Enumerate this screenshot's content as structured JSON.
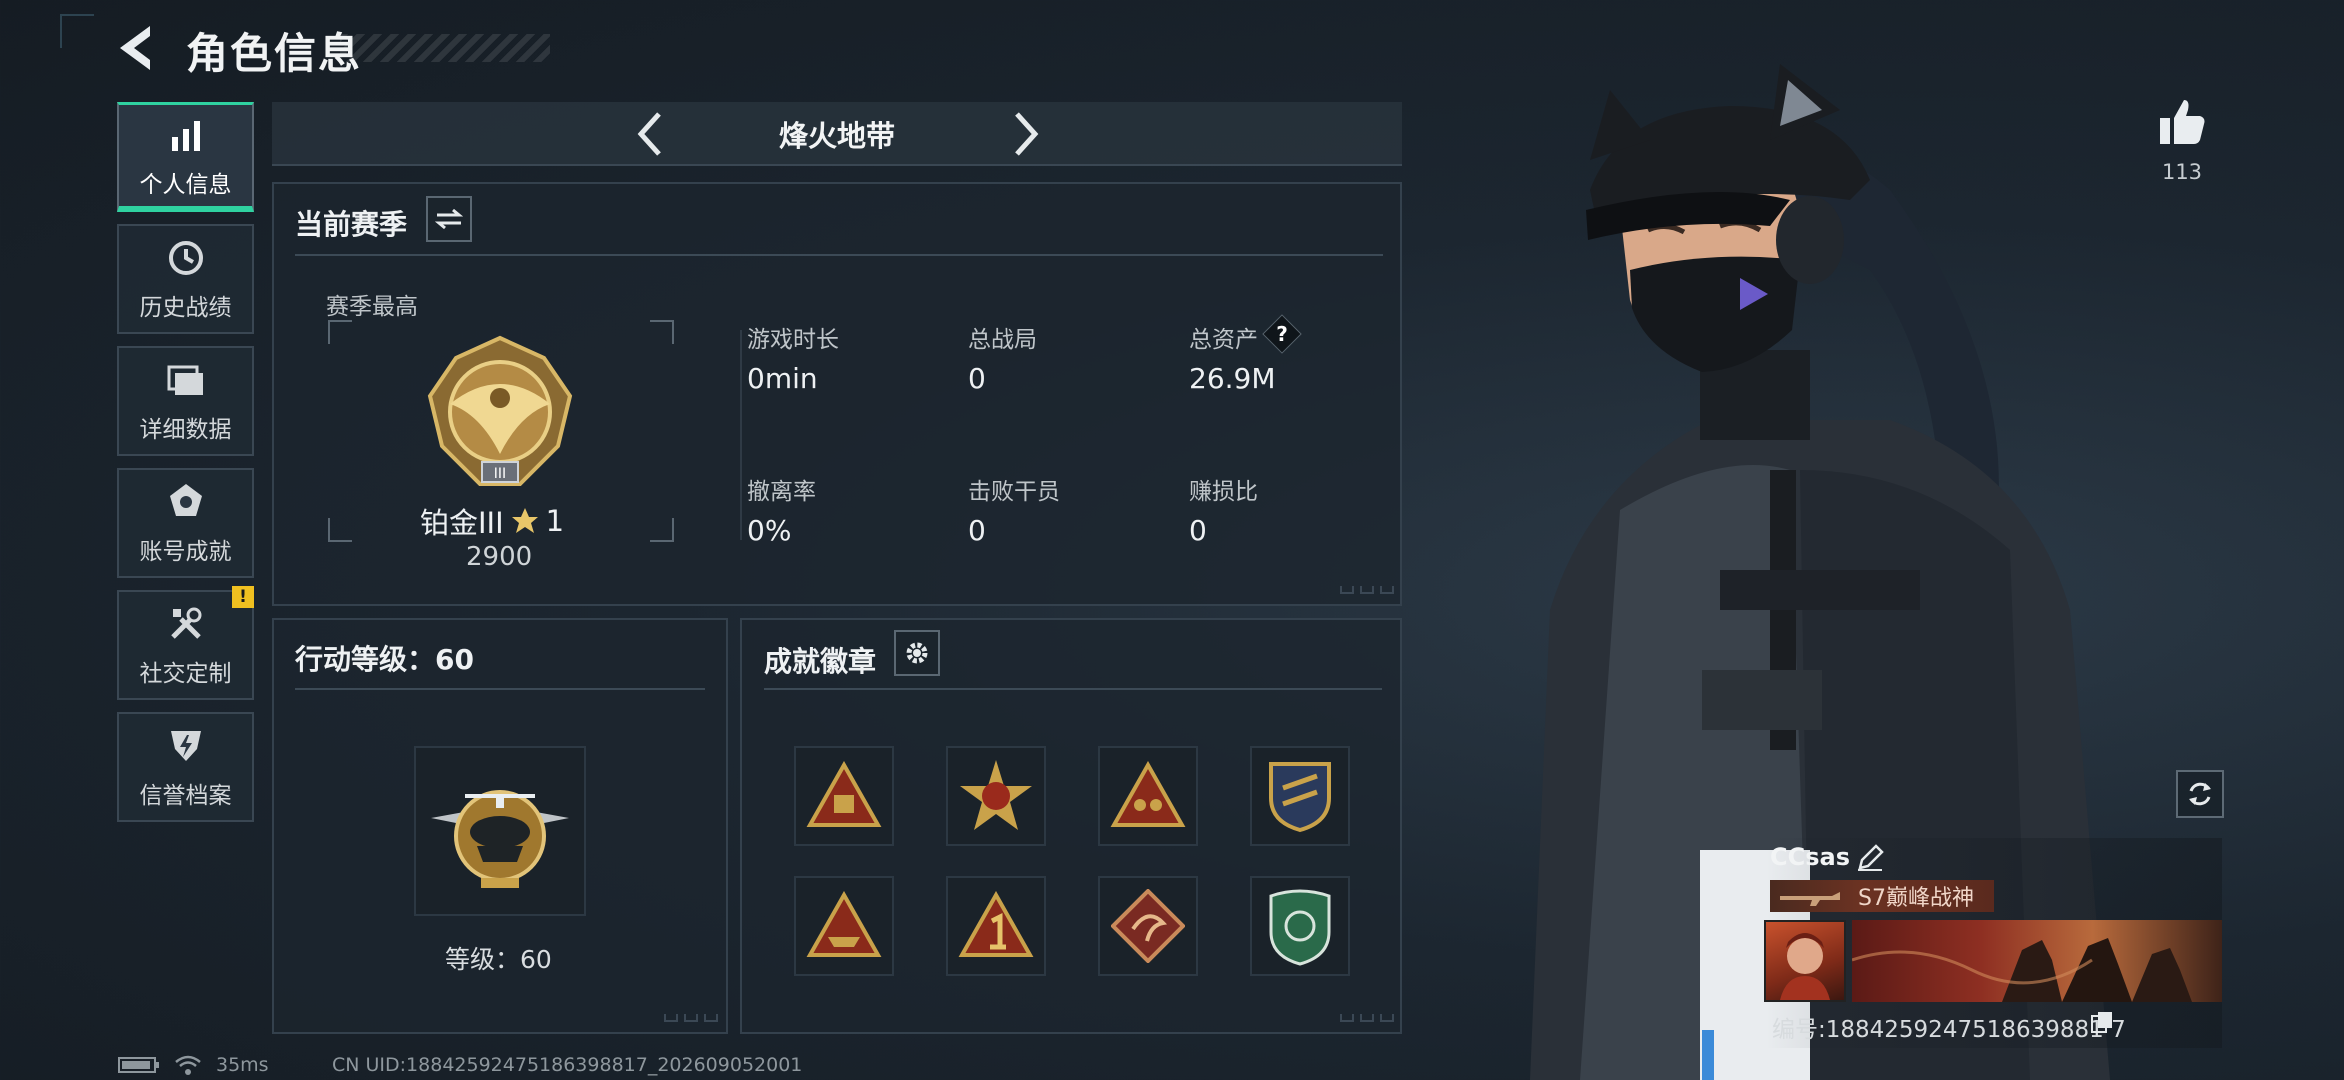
{
  "header": {
    "title": "角色信息"
  },
  "sidebar": {
    "items": [
      {
        "label": "个人信息",
        "icon": "bar-chart-icon"
      },
      {
        "label": "历史战绩",
        "icon": "history-clock-icon"
      },
      {
        "label": "详细数据",
        "icon": "folder-stack-icon"
      },
      {
        "label": "账号成就",
        "icon": "achievement-medal-icon"
      },
      {
        "label": "社交定制",
        "icon": "tools-icon"
      },
      {
        "label": "信誉档案",
        "icon": "credit-shield-icon"
      }
    ],
    "social_badge": "!"
  },
  "mode": {
    "name": "烽火地带"
  },
  "season": {
    "title": "当前赛季",
    "best_label": "赛季最高",
    "rank_name": "铂金III",
    "rank_star": "1",
    "rank_points": "2900",
    "stats": [
      {
        "label": "游戏时长",
        "value": "0min"
      },
      {
        "label": "总战局",
        "value": "0"
      },
      {
        "label": "总资产",
        "value": "26.9M",
        "help": "?"
      },
      {
        "label": "撤离率",
        "value": "0%"
      },
      {
        "label": "击败干员",
        "value": "0"
      },
      {
        "label": "赚损比",
        "value": "0"
      }
    ]
  },
  "action_level": {
    "title": "行动等级：60",
    "level_text": "等级：60"
  },
  "achievements": {
    "title": "成就徽章",
    "badges": [
      "triangle-crate-badge",
      "star-cross-badge",
      "triangle-team-badge",
      "shield-badge",
      "triangle-ship-badge",
      "triangle-number-one-badge",
      "diamond-dragon-badge",
      "green-crest-badge"
    ]
  },
  "right": {
    "like_count": "113",
    "player_name": "CCsas",
    "player_title": "S7巅峰战神",
    "player_id": "编号:1884259247518639881 7"
  },
  "status": {
    "ping": "35ms",
    "uid": "CN UID:18842592475186398817_202609052001"
  },
  "colors": {
    "accent": "#2fd2a0",
    "gold": "#c9a24a",
    "badge_warn": "#f0c020"
  }
}
